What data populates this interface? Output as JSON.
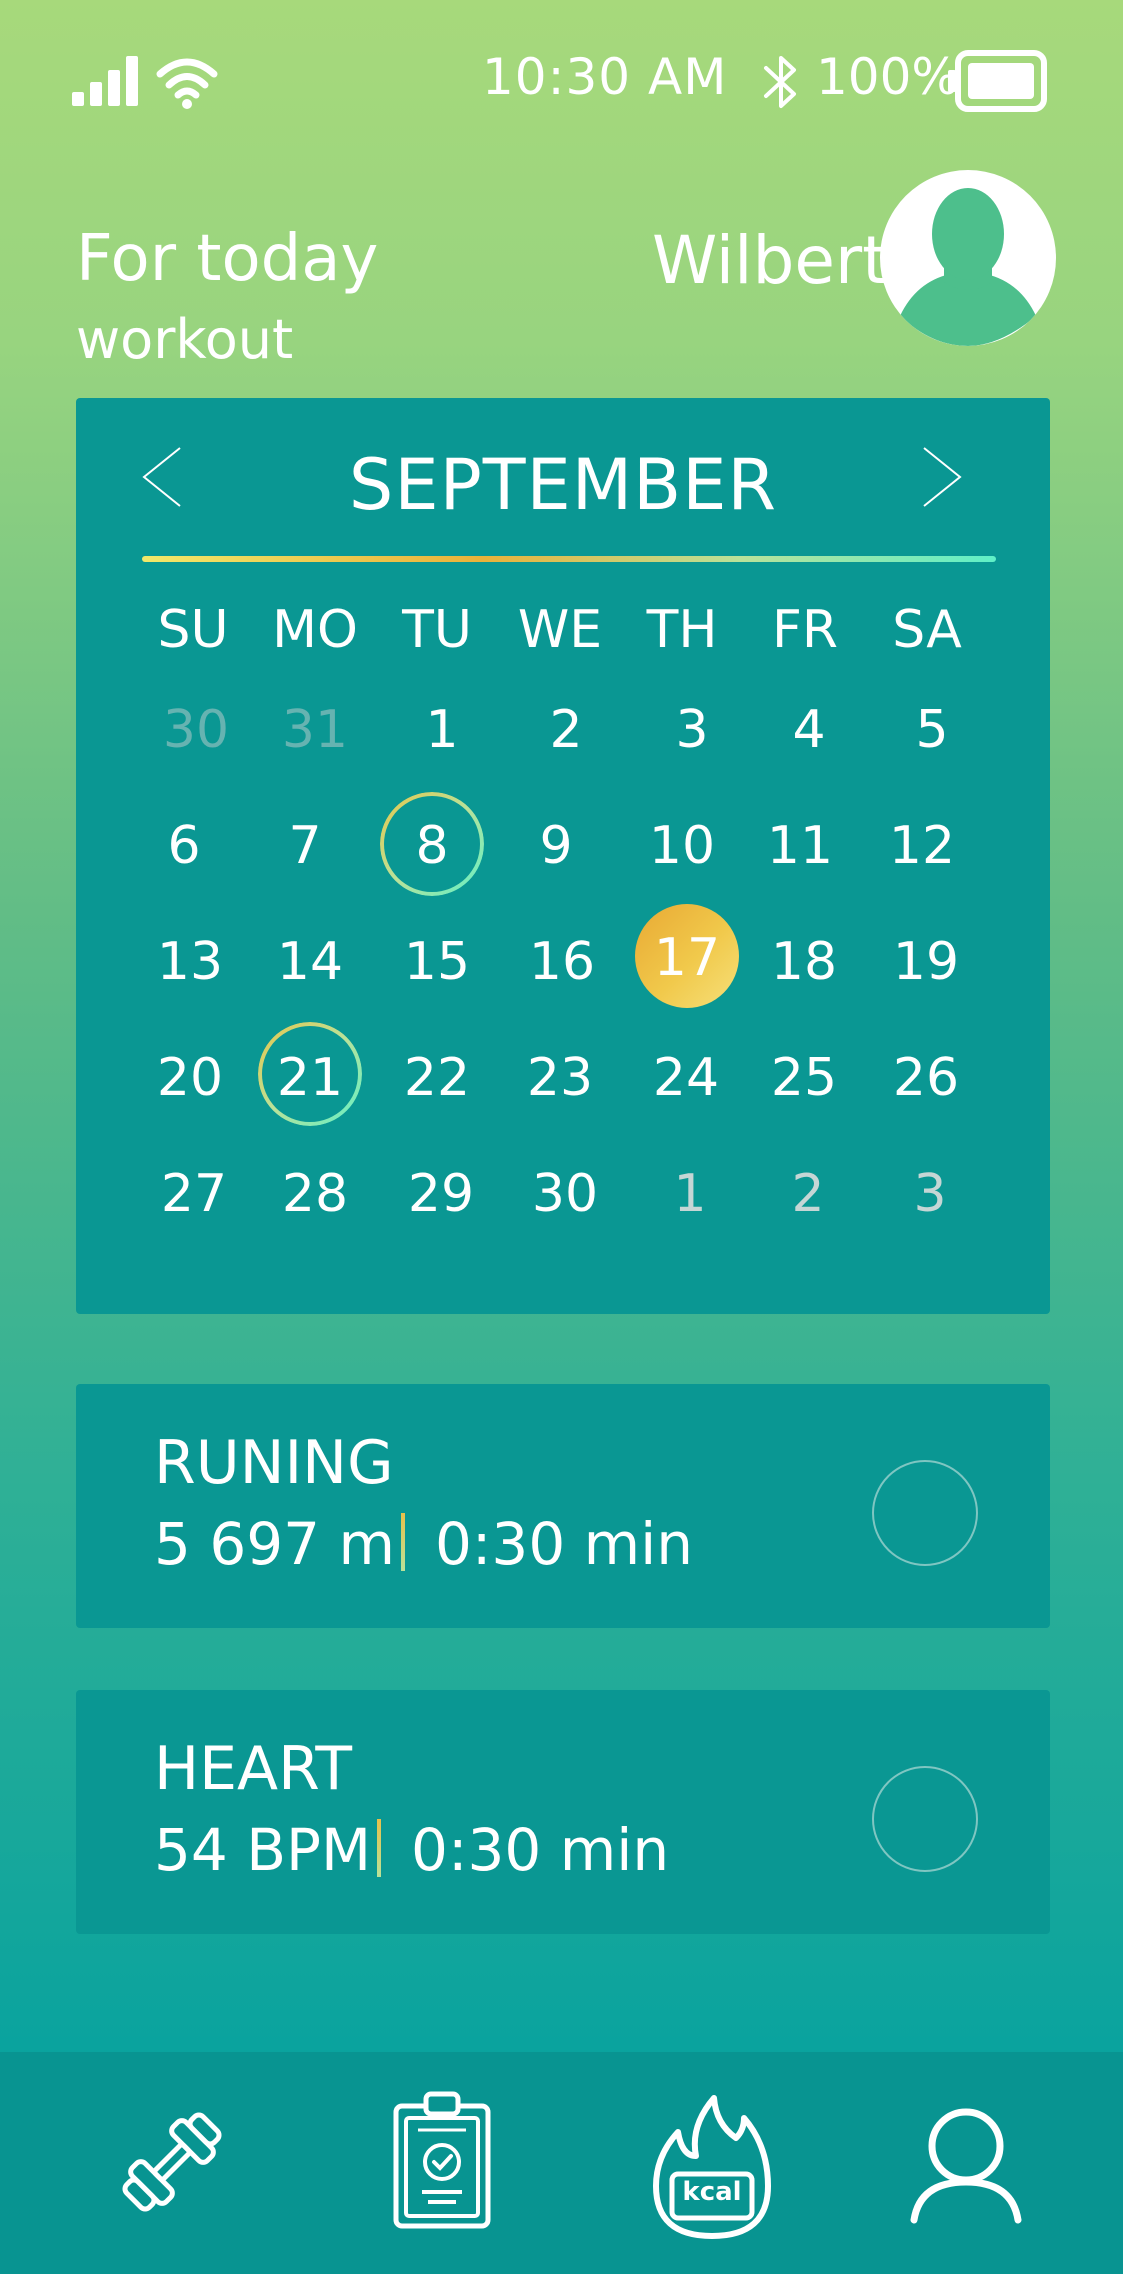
{
  "status_bar": {
    "time": "10:30 AM",
    "battery_percent": "100%",
    "icons": [
      "signal-icon",
      "wifi-icon",
      "bluetooth-icon",
      "battery-icon"
    ]
  },
  "header": {
    "title": "For today",
    "subtitle": "workout",
    "user_name": "Wilbert"
  },
  "calendar": {
    "month": "SEPTEMBER",
    "weekdays": [
      "SU",
      "MO",
      "TU",
      "WE",
      "TH",
      "FR",
      "SA"
    ],
    "weeks": [
      [
        "30",
        "31",
        "1",
        "2",
        "3",
        "4",
        "5"
      ],
      [
        "6",
        "7",
        "8",
        "9",
        "10",
        "11",
        "12"
      ],
      [
        "13",
        "14",
        "15",
        "16",
        "17",
        "18",
        "19"
      ],
      [
        "20",
        "21",
        "22",
        "23",
        "24",
        "25",
        "26"
      ],
      [
        "27",
        "28",
        "29",
        "30",
        "1",
        "2",
        "3"
      ]
    ],
    "selected_day": "17",
    "marked_days": [
      "8",
      "21"
    ]
  },
  "activities": [
    {
      "title": "RUNING",
      "value": "5 697 m",
      "duration": "0:30 min"
    },
    {
      "title": "HEART",
      "value": "54 BPM",
      "duration": "0:30 min"
    }
  ],
  "nav": {
    "kcal_label": "kcal",
    "items": [
      "dumbbell-icon",
      "clipboard-check-icon",
      "kcal-flame-icon",
      "profile-icon"
    ]
  },
  "colors": {
    "card": "#0a9793",
    "accent_gold": "#f1c94b",
    "accent_mint": "#5ff0c8",
    "nav": "#089491"
  }
}
